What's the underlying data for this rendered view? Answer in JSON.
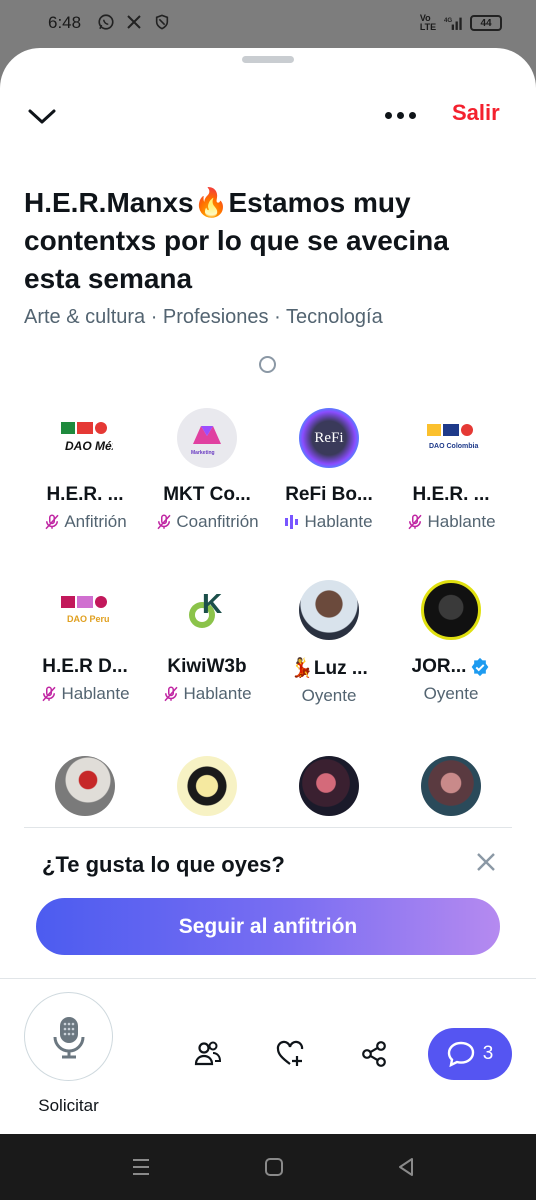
{
  "status_bar": {
    "time": "6:48",
    "battery": "44",
    "network": "4G"
  },
  "header": {
    "leave_label": "Salir"
  },
  "space": {
    "title": "H.E.R.Manxs🔥Estamos muy contentxs por lo que se avecina esta semana",
    "topics": "Arte & cultura · Profesiones · Tecnología"
  },
  "participants": [
    {
      "name": "H.E.R. ...",
      "role": "Anfitrión",
      "status": "muted",
      "logo": "DAO México"
    },
    {
      "name": "MKT Co...",
      "role": "Coanfitrión",
      "status": "muted",
      "logo": "Marketing"
    },
    {
      "name": "ReFi Bo...",
      "role": "Hablante",
      "status": "speaking",
      "logo": "ReFi"
    },
    {
      "name": "H.E.R. ...",
      "role": "Hablante",
      "status": "muted",
      "logo": "DAO Colombia"
    },
    {
      "name": "H.E.R D...",
      "role": "Hablante",
      "status": "muted",
      "logo": "DAO Peru"
    },
    {
      "name": "KiwiW3b",
      "role": "Hablante",
      "status": "muted",
      "logo": "K"
    },
    {
      "name": "💃Luz ...",
      "role": "Oyente",
      "status": "listener",
      "logo": ""
    },
    {
      "name": "JOR...",
      "role": "Oyente",
      "status": "listener",
      "logo": "",
      "verified": true
    }
  ],
  "follow_prompt": {
    "question": "¿Te gusta lo que oyes?",
    "button": "Seguir al anfitrión"
  },
  "toolbar": {
    "request_label": "Solicitar",
    "comments_count": "3"
  },
  "colors": {
    "accent": "#5555f2",
    "leave": "#f4212e",
    "muted_icon": "#c026a3",
    "speaking_icon": "#7856ff"
  }
}
